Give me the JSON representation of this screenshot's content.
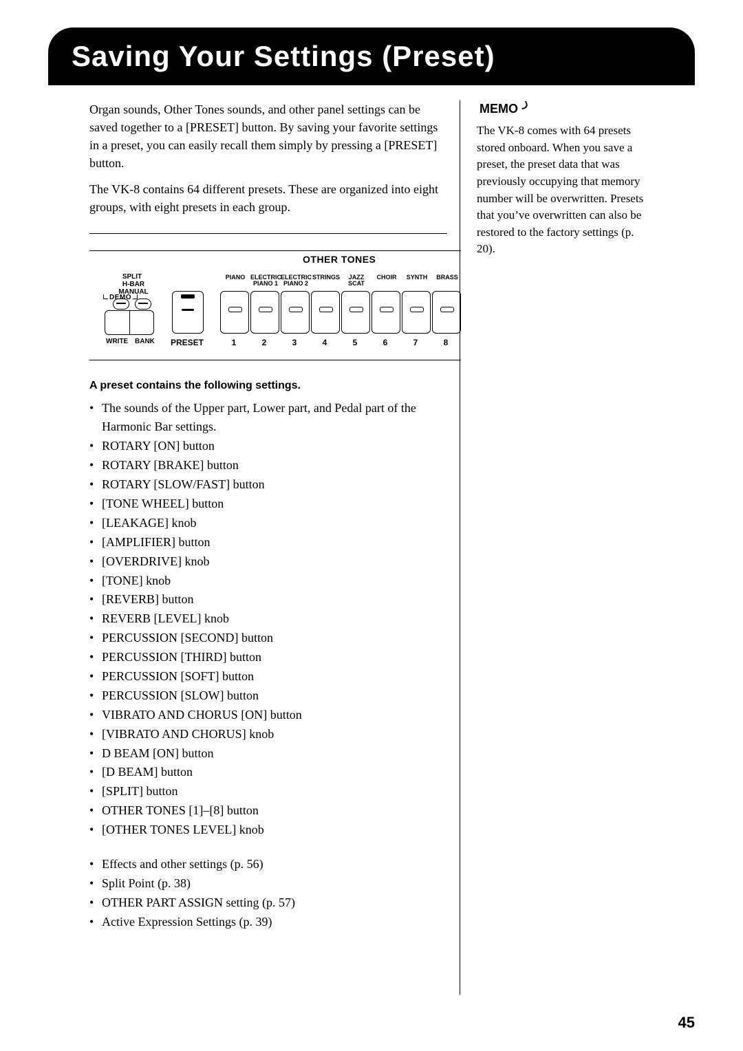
{
  "title": "Saving Your Settings (Preset)",
  "intro_p1": "Organ sounds, Other Tones sounds, and other panel settings can be saved together to a [PRESET] button. By saving your favorite settings in a preset, you can easily recall them simply by pressing a [PRESET] button.",
  "intro_p2": "The VK-8 contains 64 different presets. These are organized into eight groups, with eight presets in each group.",
  "panel": {
    "other_tones_title": "OTHER TONES",
    "split_label": "SPLIT",
    "hbar_line1": "H-BAR",
    "hbar_line2": "MANUAL",
    "demo_label": "DEMO",
    "write_label": "WRITE",
    "bank_label": "BANK",
    "preset_label": "PRESET",
    "tones": [
      {
        "label": "PIANO",
        "num": "1"
      },
      {
        "label": "ELECTRIC PIANO 1",
        "num": "2"
      },
      {
        "label": "ELECTRIC PIANO 2",
        "num": "3"
      },
      {
        "label": "STRINGS",
        "num": "4"
      },
      {
        "label": "JAZZ SCAT",
        "num": "5"
      },
      {
        "label": "CHOIR",
        "num": "6"
      },
      {
        "label": "SYNTH",
        "num": "7"
      },
      {
        "label": "BRASS",
        "num": "8"
      }
    ]
  },
  "sub_heading": "A preset contains the following settings.",
  "settings_list_a": [
    "The sounds of the Upper part, Lower part, and Pedal part of the Harmonic Bar settings.",
    "ROTARY [ON] button",
    "ROTARY [BRAKE] button",
    "ROTARY [SLOW/FAST] button",
    "[TONE WHEEL] button",
    "[LEAKAGE] knob",
    "[AMPLIFIER] button",
    "[OVERDRIVE] knob",
    "[TONE] knob",
    "[REVERB] button",
    "REVERB [LEVEL] knob",
    "PERCUSSION [SECOND] button",
    "PERCUSSION [THIRD] button",
    "PERCUSSION [SOFT] button",
    "PERCUSSION [SLOW] button",
    "VIBRATO AND CHORUS [ON] button",
    "[VIBRATO AND CHORUS] knob",
    "D BEAM [ON] button",
    "[D BEAM] button",
    "[SPLIT] button",
    "OTHER TONES [1]–[8] button",
    "[OTHER TONES LEVEL] knob"
  ],
  "settings_list_b": [
    "Effects and other settings (p. 56)",
    "Split Point (p. 38)",
    "OTHER PART ASSIGN setting (p. 57)",
    "Active Expression Settings (p. 39)"
  ],
  "memo_label": "MEMO",
  "memo_body": "The VK-8 comes with 64 presets stored onboard. When you save a preset, the preset data that was previously occupying that memory number will be overwritten. Presets that you’ve overwritten can also be restored to the factory settings (p. 20).",
  "page_number": "45"
}
